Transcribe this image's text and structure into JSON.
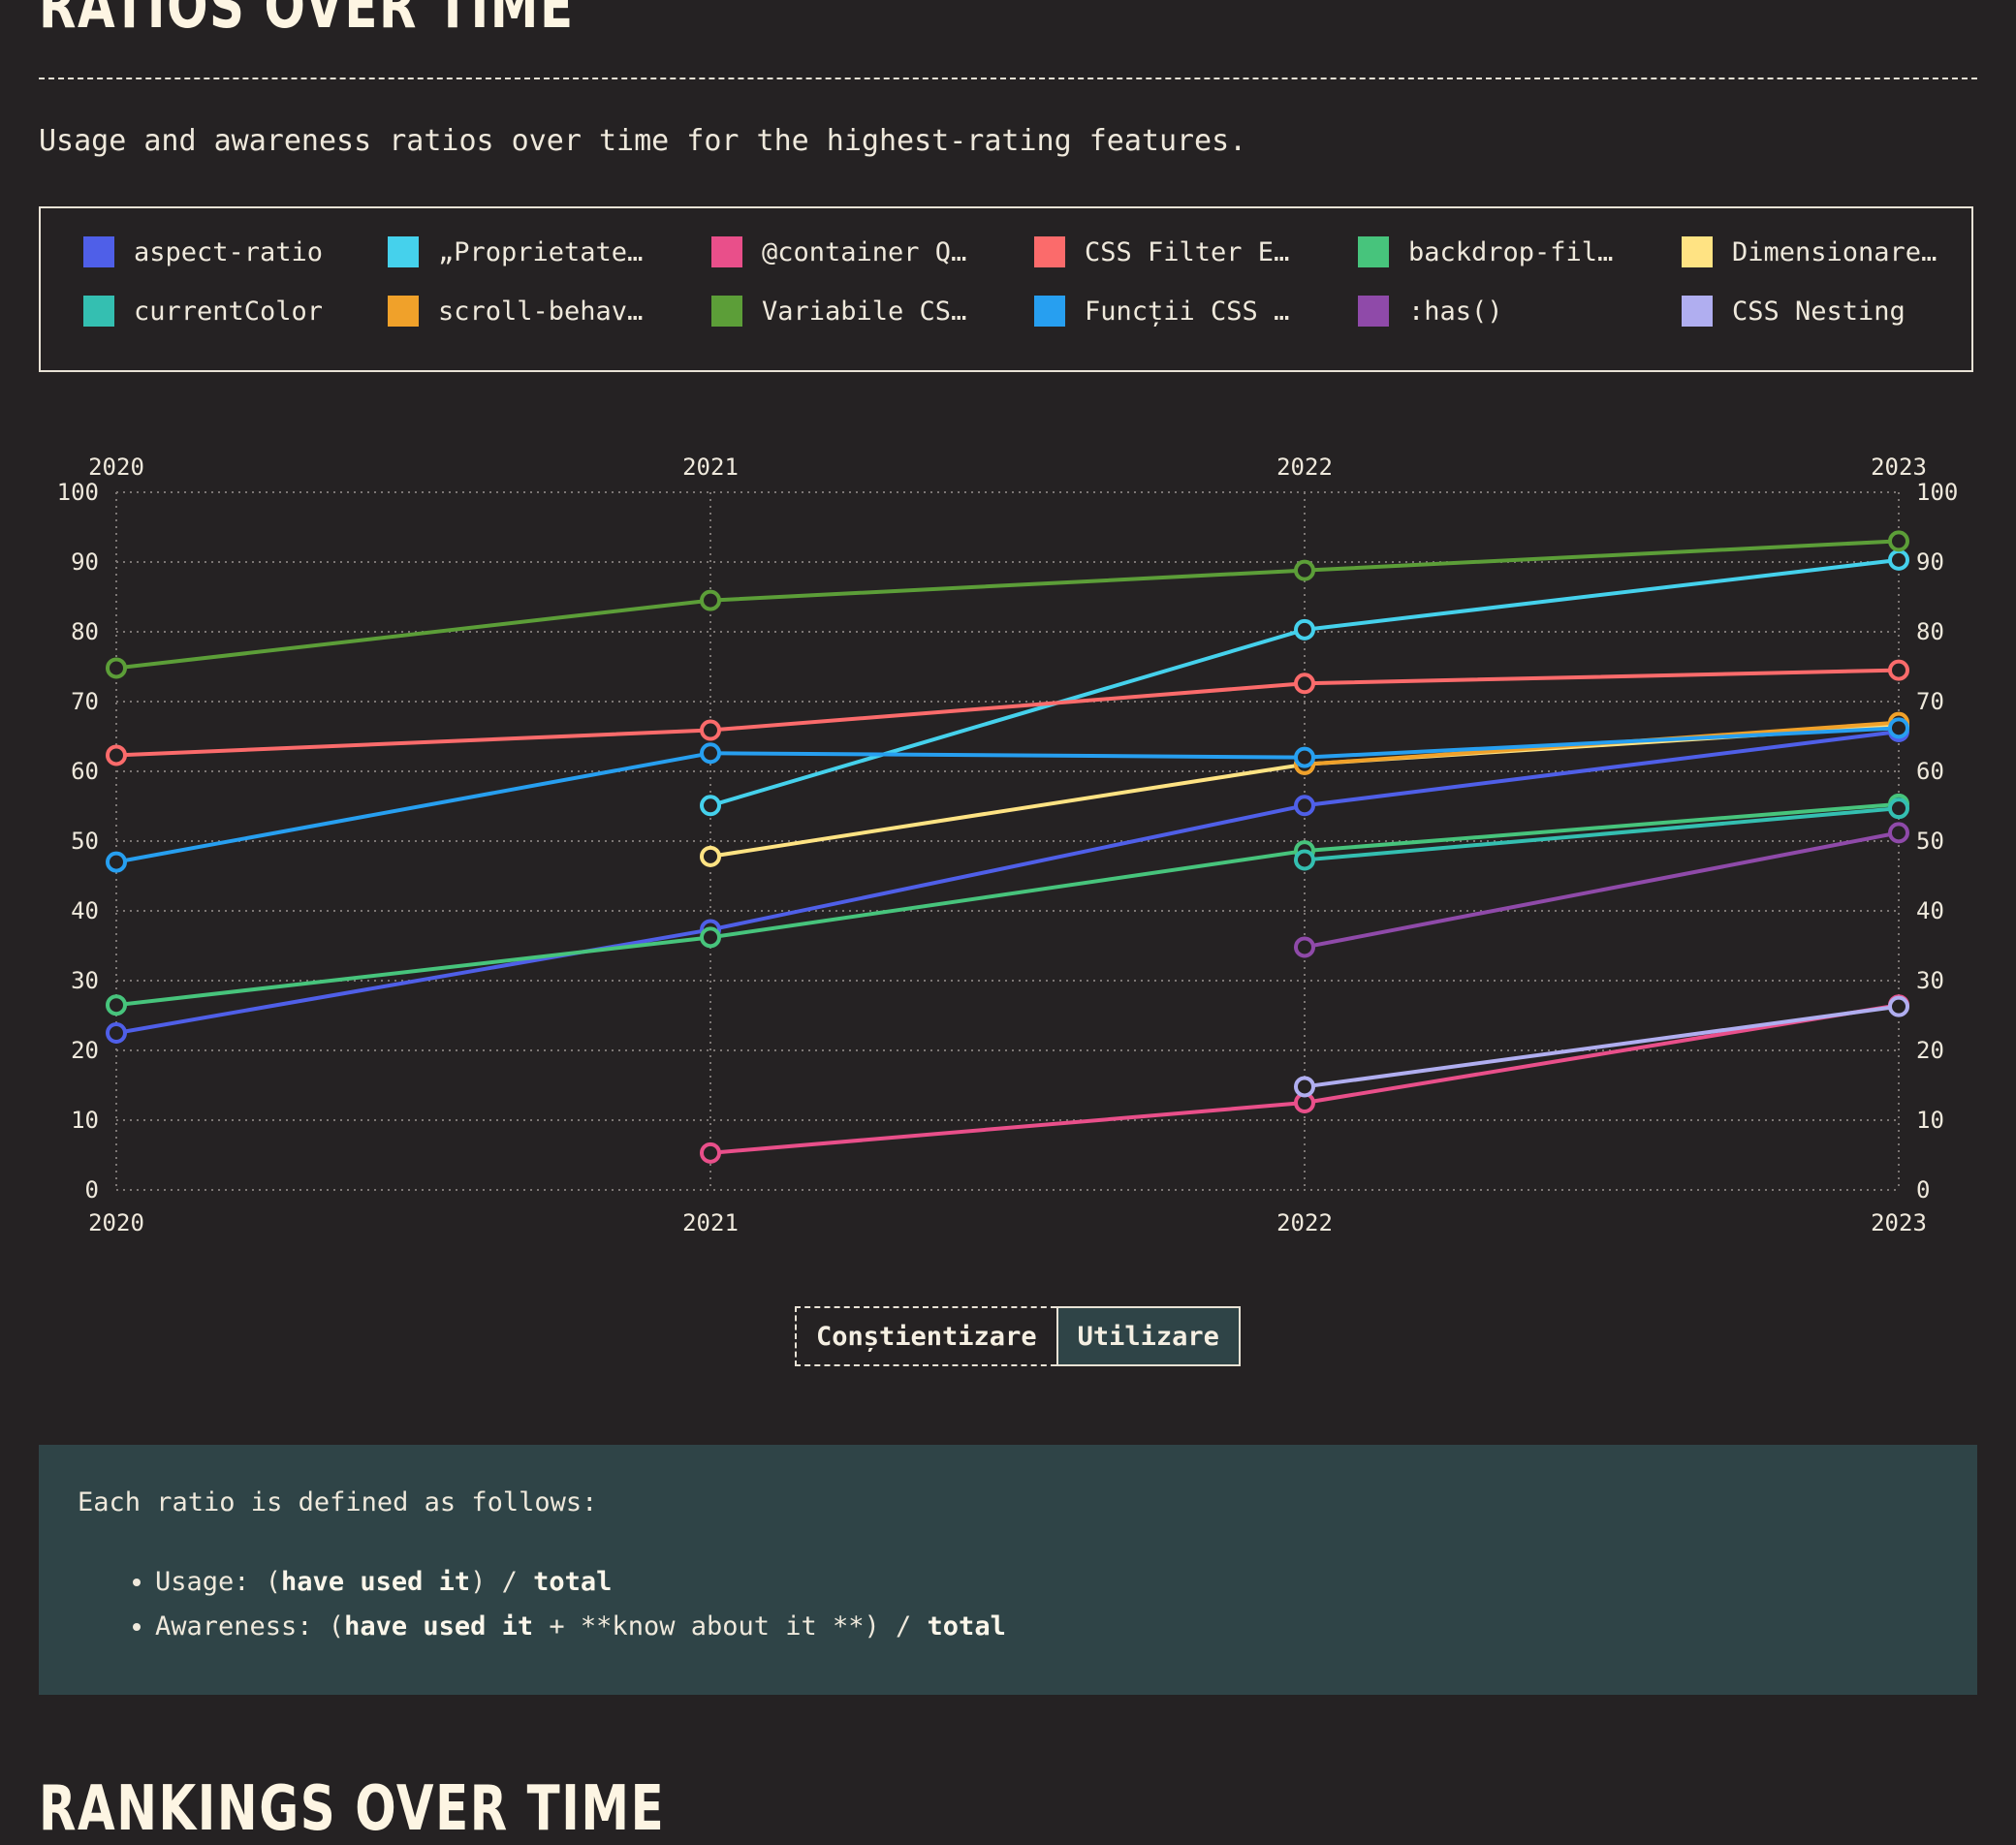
{
  "page": {
    "section_heading": "RATIOS OVER TIME",
    "subtitle": "Usage and awareness ratios over time for the highest-rating features.",
    "next_section_heading": "RANKINGS OVER TIME"
  },
  "legend": [
    {
      "label": "aspect-ratio",
      "color": "#4f5fe8"
    },
    {
      "label": "„Proprietate…",
      "color": "#45d1ec"
    },
    {
      "label": "@container Q…",
      "color": "#e94f8a"
    },
    {
      "label": "CSS Filter E…",
      "color": "#fb6b6b"
    },
    {
      "label": "backdrop-fil…",
      "color": "#47c47c"
    },
    {
      "label": "Dimensionare…",
      "color": "#ffe383"
    },
    {
      "label": "currentColor",
      "color": "#34bfb1"
    },
    {
      "label": "scroll-behav…",
      "color": "#f0a12a"
    },
    {
      "label": "Variabile CS…",
      "color": "#5c9e38"
    },
    {
      "label": "Funcții CSS …",
      "color": "#279ff0"
    },
    {
      "label": ":has()",
      "color": "#8f4aa9"
    },
    {
      "label": "CSS Nesting",
      "color": "#b0aef0"
    }
  ],
  "toggle": {
    "awareness_label": "Conștientizare",
    "usage_label": "Utilizare",
    "selected": "Utilizare"
  },
  "note": {
    "intro": "Each ratio is defined as follows:",
    "usage_prefix": "Usage: (",
    "usage_strong1": "have used it",
    "usage_mid": ") / ",
    "usage_strong2": "total",
    "awareness_prefix": "Awareness: (",
    "awareness_strong1": "have used it",
    "awareness_mid": " + **know about it **) / ",
    "awareness_strong2": "total"
  },
  "chart_data": {
    "type": "line",
    "x": [
      2020,
      2021,
      2022,
      2023
    ],
    "ylim": [
      0,
      100
    ],
    "yticks": [
      0,
      10,
      20,
      30,
      40,
      50,
      60,
      70,
      80,
      90,
      100
    ],
    "grid": true,
    "legend_placement": "top",
    "series": [
      {
        "name": "aspect-ratio",
        "color": "#4f5fe8",
        "values": [
          22.5,
          37.3,
          55.1,
          65.7
        ]
      },
      {
        "name": "„Proprietate…",
        "color": "#45d1ec",
        "values": [
          null,
          55.1,
          80.3,
          90.3
        ]
      },
      {
        "name": "@container Q…",
        "color": "#e94f8a",
        "values": [
          null,
          5.3,
          12.5,
          26.5
        ]
      },
      {
        "name": "CSS Filter E…",
        "color": "#fb6b6b",
        "values": [
          62.3,
          65.9,
          72.6,
          74.5
        ]
      },
      {
        "name": "backdrop-fil…",
        "color": "#47c47c",
        "values": [
          26.5,
          36.2,
          48.6,
          55.3
        ]
      },
      {
        "name": "Dimensionare…",
        "color": "#ffe383",
        "values": [
          null,
          47.8,
          61.0,
          66.5
        ]
      },
      {
        "name": "currentColor",
        "color": "#34bfb1",
        "values": [
          null,
          null,
          47.3,
          54.7
        ]
      },
      {
        "name": "scroll-behav…",
        "color": "#f0a12a",
        "values": [
          null,
          null,
          61.0,
          67.0
        ]
      },
      {
        "name": "Variabile CS…",
        "color": "#5c9e38",
        "values": [
          74.8,
          84.5,
          88.8,
          93.0
        ]
      },
      {
        "name": "Funcții CSS …",
        "color": "#279ff0",
        "values": [
          47.0,
          62.6,
          62.0,
          66.2
        ]
      },
      {
        "name": ":has()",
        "color": "#8f4aa9",
        "values": [
          null,
          null,
          34.8,
          51.2
        ]
      },
      {
        "name": "CSS Nesting",
        "color": "#b0aef0",
        "values": [
          null,
          null,
          14.8,
          26.3
        ]
      }
    ]
  }
}
